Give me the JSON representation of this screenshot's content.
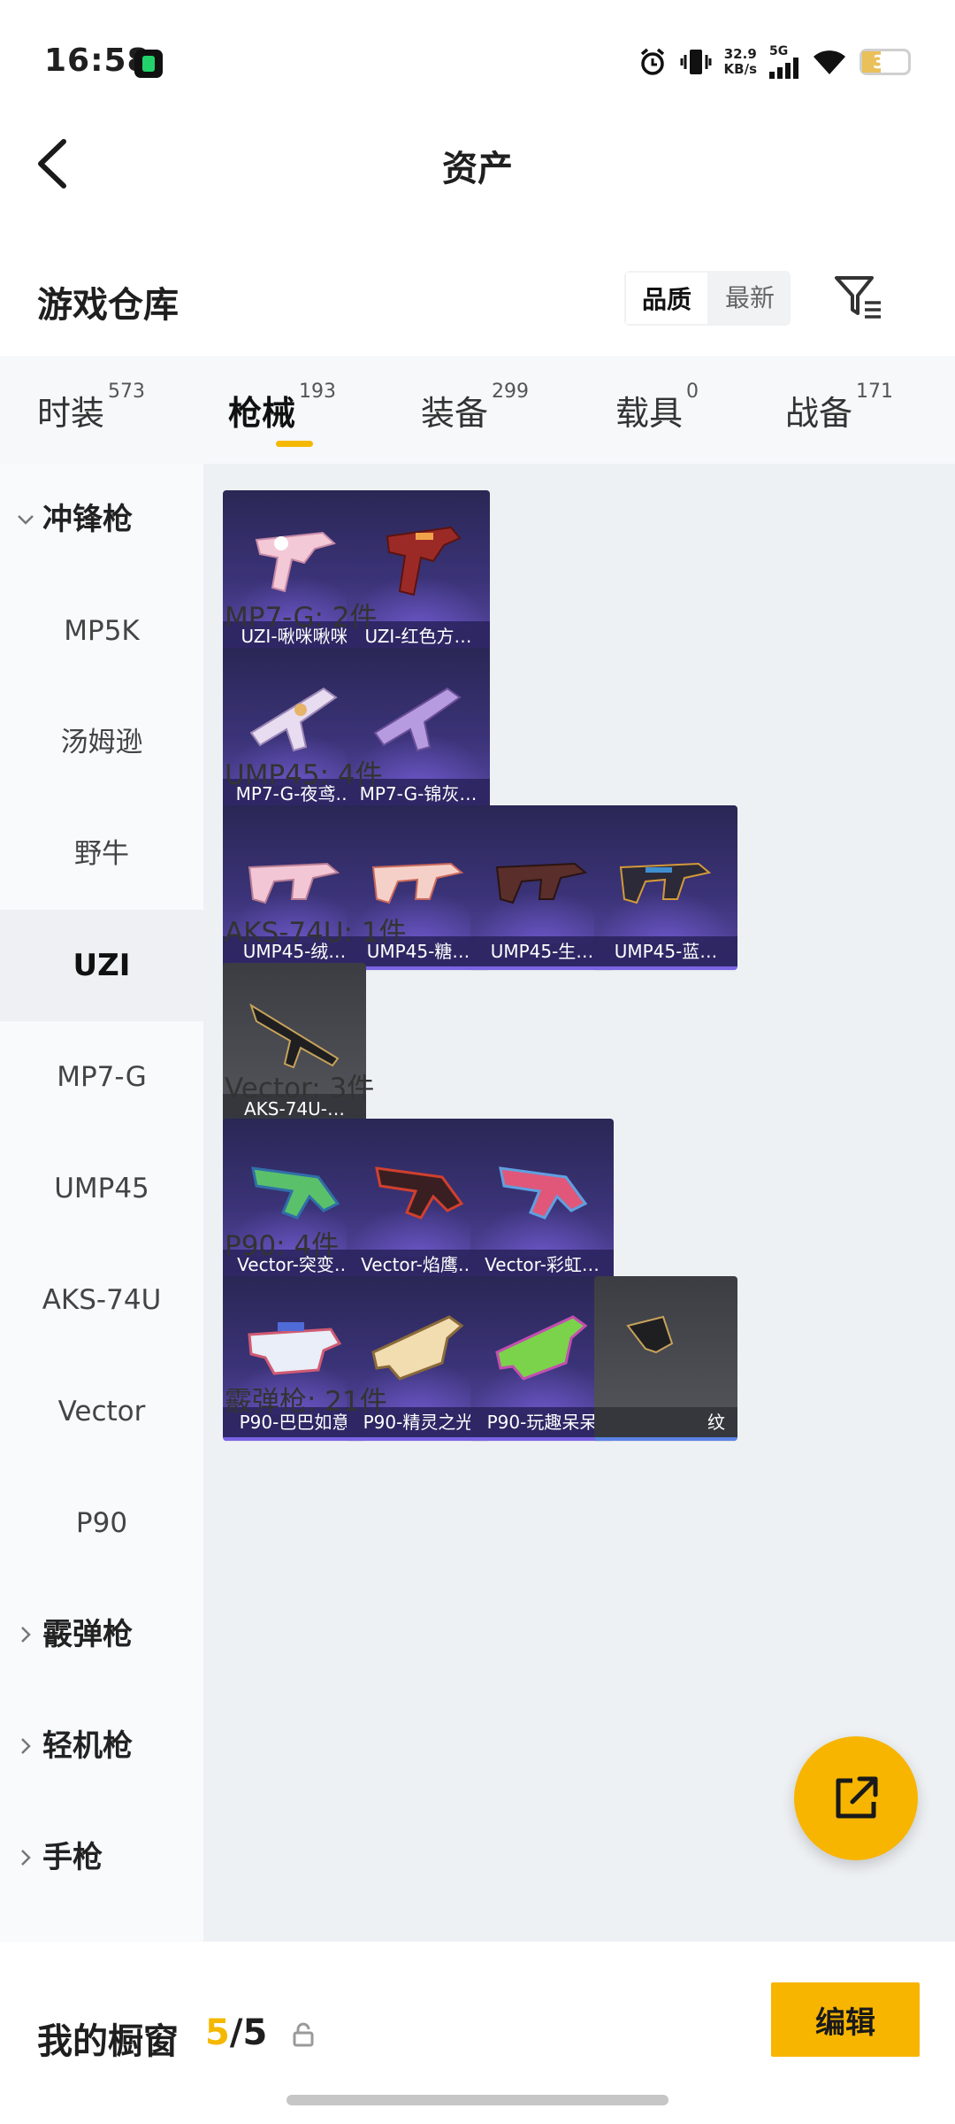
{
  "status_bar": {
    "time": "16:58",
    "speed_value": "32.9",
    "speed_unit": "KB/s",
    "network": "5G",
    "battery": "37",
    "icons": [
      "music-app-icon",
      "alarm-icon",
      "vibrate-icon",
      "signal-icon",
      "wifi-icon",
      "battery-icon"
    ]
  },
  "header": {
    "title": "资产",
    "back_icon": "chevron-left-icon"
  },
  "warehouse": {
    "title": "游戏仓库",
    "sort_options": [
      "品质",
      "最新"
    ],
    "sort_selected": "品质",
    "filter_icon": "filter-icon"
  },
  "tabs": [
    {
      "label": "时装",
      "count": "573"
    },
    {
      "label": "枪械",
      "count": "193",
      "active": true
    },
    {
      "label": "装备",
      "count": "299"
    },
    {
      "label": "载具",
      "count": "0"
    },
    {
      "label": "战备",
      "count": "171"
    }
  ],
  "sidebar": {
    "groups": [
      {
        "label": "冲锋枪",
        "expanded": true
      },
      {
        "label": "霰弹枪"
      },
      {
        "label": "轻机枪"
      },
      {
        "label": "手枪"
      }
    ],
    "items": [
      "MP5K",
      "汤姆逊",
      "野牛",
      "UZI",
      "MP7-G",
      "UMP45",
      "AKS-74U",
      "Vector",
      "P90"
    ],
    "active_item": "UZI"
  },
  "sections": [
    {
      "title": "",
      "cards": [
        "UZI-啾咪啾咪",
        "UZI-红色方…"
      ]
    },
    {
      "title": "MP7-G: 2件",
      "cards": [
        "MP7-G-夜鸢…",
        "MP7-G-锦灰…"
      ]
    },
    {
      "title": "UMP45: 4件",
      "cards": [
        "UMP45-绒…",
        "UMP45-糖…",
        "UMP45-生…",
        "UMP45-蓝…"
      ]
    },
    {
      "title": "AKS-74U: 1件",
      "cards": [
        "AKS-74U-…"
      ]
    },
    {
      "title": "Vector: 3件",
      "cards": [
        "Vector-突变…",
        "Vector-焰鹰…",
        "Vector-彩虹…"
      ]
    },
    {
      "title": "P90: 4件",
      "cards": [
        "P90-巴巴如意",
        "P90-精灵之光",
        "P90-玩趣呆呆",
        "纹"
      ]
    },
    {
      "title": "霰弹枪: 21件",
      "cards": []
    }
  ],
  "bottom": {
    "showcase_title": "我的橱窗",
    "showcase_current": "5",
    "showcase_total": "/5",
    "edit_label": "编辑",
    "fab_icon": "share-external-icon"
  },
  "colors": {
    "accent": "#f7b500",
    "card_purple": "#3b3378",
    "card_grey": "#4a4c52"
  }
}
